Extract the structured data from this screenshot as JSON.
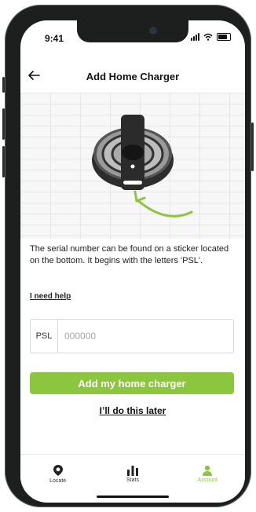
{
  "status": {
    "time": "9:41"
  },
  "header": {
    "title": "Add Home Charger"
  },
  "content": {
    "description": "The serial number can be found on a sticker located on the bottom. It begins with the letters 'PSL'.",
    "help_link": "I need help",
    "serial": {
      "prefix": "PSL",
      "placeholder": "000000"
    },
    "primary_button": "Add my home charger",
    "secondary_link": "I’ll do this later"
  },
  "tabbar": {
    "items": [
      {
        "label": "Locate",
        "icon": "location-pin-icon"
      },
      {
        "label": "Stats",
        "icon": "bar-chart-icon"
      },
      {
        "label": "Account",
        "icon": "user-icon",
        "active": true
      }
    ]
  },
  "colors": {
    "accent": "#8cc63e"
  }
}
